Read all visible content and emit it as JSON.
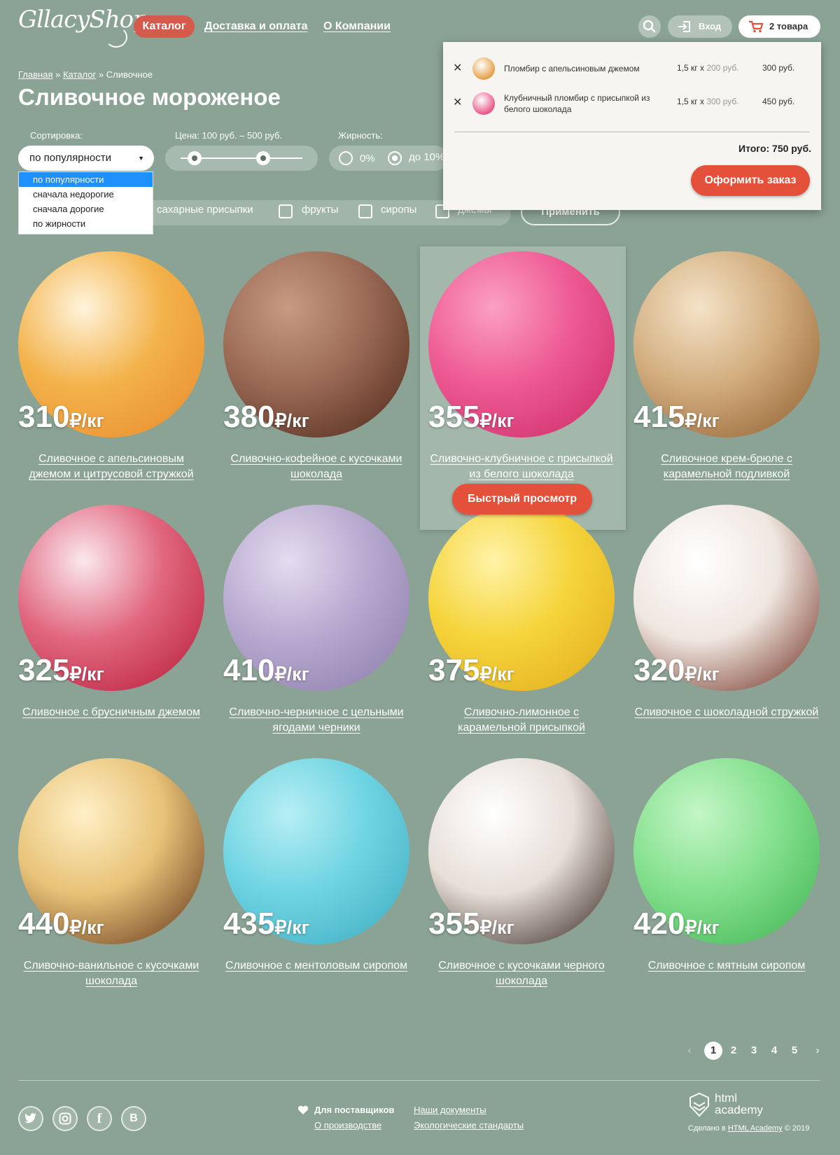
{
  "header": {
    "logo": "GllacyShop",
    "nav": [
      "Каталог",
      "Доставка и оплата",
      "О Компании"
    ],
    "login": "Вход",
    "cart": "2 товара"
  },
  "breadcrumb": [
    "Главная",
    "»",
    "Каталог",
    "»",
    "Сливочное"
  ],
  "page_title": "Сливочное мороженое",
  "filters": {
    "sort_label": "Сортировка:",
    "sort_value": "по популярности",
    "sort_options": [
      "по популярности",
      "сначала недорогие",
      "сначала дорогие",
      "по жирности"
    ],
    "price_label": "Цена: 100 руб. – 500 руб.",
    "price_min": 100,
    "price_max": 500,
    "fat_label": "Жирность:",
    "fat_options": [
      "0%",
      "до 10%"
    ],
    "fat_selected": "до 10%",
    "checkbox_options": [
      "сахарные присыпки",
      "фрукты",
      "сиропы",
      "джемы"
    ],
    "apply": "Применить"
  },
  "cart_popup": {
    "items": [
      {
        "name": "Пломбир с апельсиновым джемом",
        "qty": "1,5 кг x",
        "unit_price": "200 руб.",
        "sum": "300 руб.",
        "color": "#e6a24a"
      },
      {
        "name": "Клубничный пломбир с присыпкой из белого шоколада",
        "qty": "1,5 кг x",
        "unit_price": "300 руб.",
        "sum": "450 руб.",
        "color": "#e8588a"
      }
    ],
    "total": "Итого: 750 руб.",
    "order_button": "Оформить заказ"
  },
  "currency_unit": "₽/кг",
  "products": [
    {
      "price": "310",
      "name": "Сливочное с апельсиновым джемом и цитрусовой стружкой",
      "colors": [
        "#fff4dc",
        "#f3b24a",
        "#e88a2a"
      ]
    },
    {
      "price": "380",
      "name": "Сливочно-кофейное с кусочками шоколада",
      "colors": [
        "#c79a82",
        "#9b6a55",
        "#4a2518"
      ]
    },
    {
      "price": "355",
      "name": "Сливочно-клубничное с присыпкой из белого шоколада",
      "colors": [
        "#fba0c2",
        "#ee5a93",
        "#c92a66"
      ]
    },
    {
      "price": "415",
      "name": "Сливочное крем-брюле с карамельной подливкой",
      "colors": [
        "#f4e3c8",
        "#d2ad7e",
        "#8c5a2c"
      ]
    },
    {
      "price": "325",
      "name": "Сливочное с брусничным джемом",
      "colors": [
        "#fbe9ee",
        "#e1677f",
        "#b51935"
      ]
    },
    {
      "price": "410",
      "name": "Сливочно-черничное с цельными ягодами черники",
      "colors": [
        "#e4dcef",
        "#b8a9cf",
        "#8a7aaa"
      ]
    },
    {
      "price": "375",
      "name": "Сливочно-лимонное с карамельной присыпкой",
      "colors": [
        "#fff3a8",
        "#f5d43a",
        "#e1a91c"
      ]
    },
    {
      "price": "320",
      "name": "Сливочное с шоколадной стружкой",
      "colors": [
        "#ffffff",
        "#efe6df",
        "#6a2416"
      ]
    },
    {
      "price": "440",
      "name": "Сливочно-ванильное с кусочками шоколада",
      "colors": [
        "#fff0c7",
        "#e8c277",
        "#5b2e17"
      ]
    },
    {
      "price": "435",
      "name": "Сливочное с ментоловым сиропом",
      "colors": [
        "#b7eef4",
        "#6fd4e2",
        "#3caac0"
      ]
    },
    {
      "price": "355",
      "name": "Сливочное с кусочками черного шоколада",
      "colors": [
        "#ffffff",
        "#e7dfd8",
        "#2a1a14"
      ]
    },
    {
      "price": "420",
      "name": "Сливочное с мятным сиропом",
      "colors": [
        "#c4f6c6",
        "#84e08e",
        "#3fb24f"
      ]
    }
  ],
  "quick_view": "Быстрый просмотр",
  "pagination": [
    "1",
    "2",
    "3",
    "4",
    "5"
  ],
  "pagination_current": "1",
  "footer": {
    "social": [
      "twitter-icon",
      "instagram-icon",
      "facebook-icon",
      "vk-icon"
    ],
    "suppliers": "Для поставщиков",
    "production": "О производстве",
    "docs": "Наши документы",
    "eco": "Экологические стандарты",
    "academy_logo": "html academy",
    "made_by_prefix": "Сделано в",
    "made_by_link": "HTML Academy",
    "made_by_year": "© 2019"
  },
  "colors": {
    "background": "#8aa394",
    "accent": "#e4503a",
    "nav_active": "#d55a4c",
    "dropdown_selected": "#1e90ff"
  }
}
